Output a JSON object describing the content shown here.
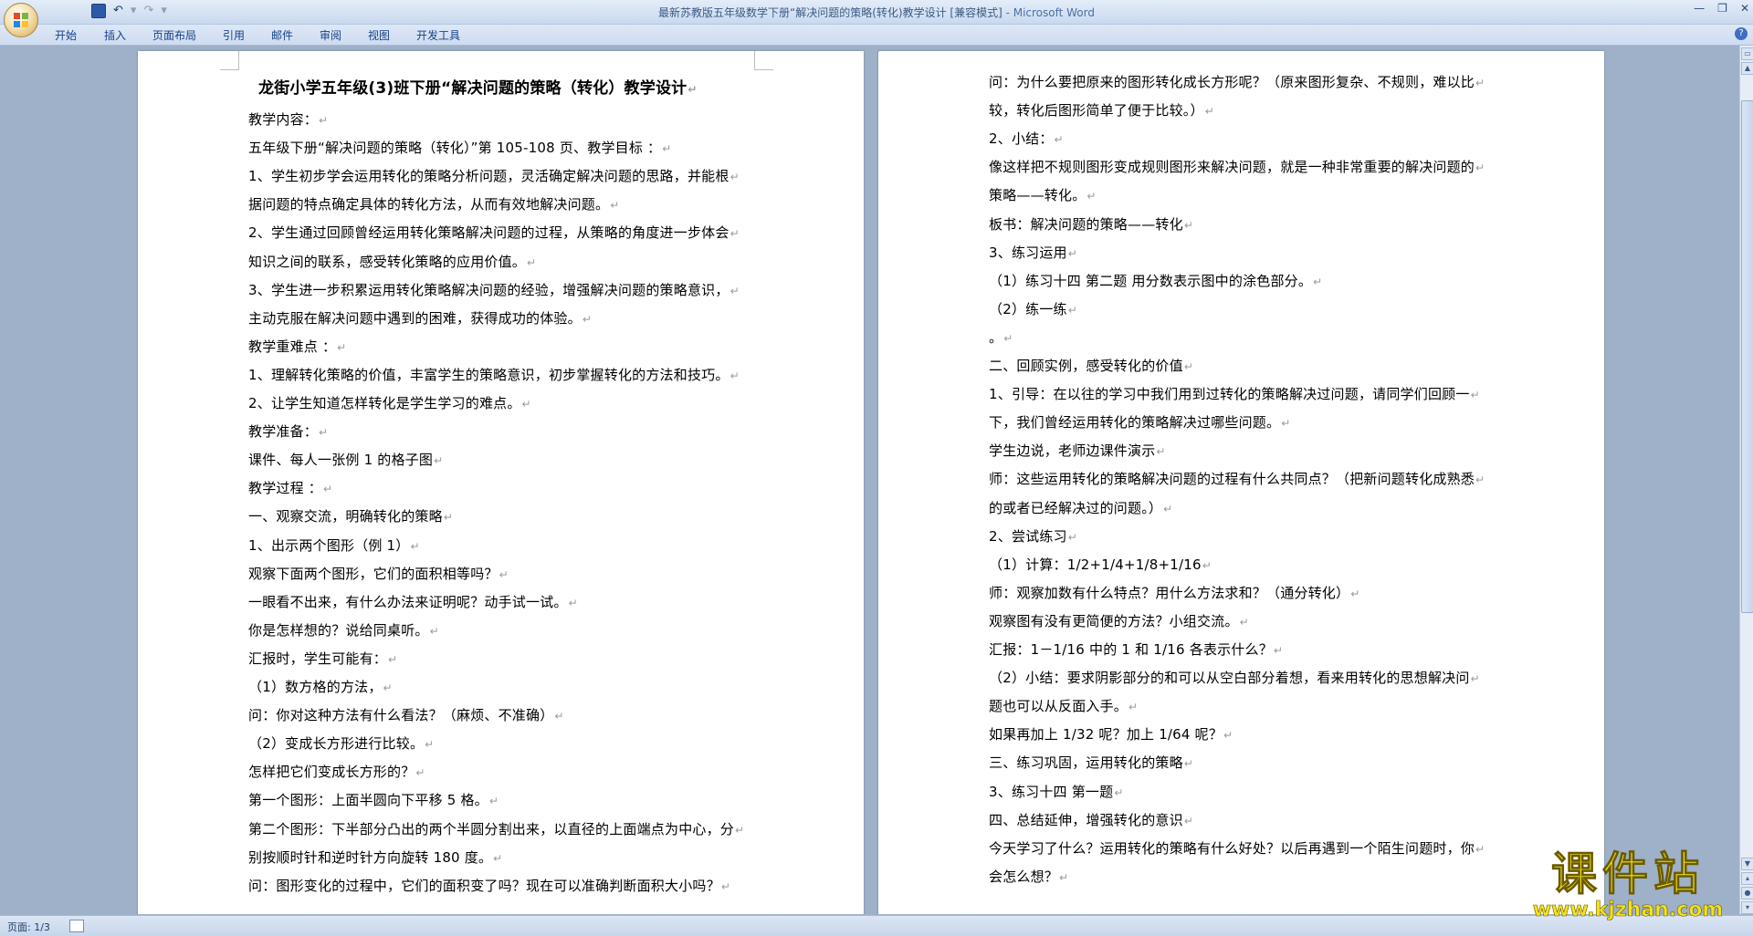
{
  "window": {
    "title": "最新苏教版五年级数学下册“解决问题的策略(转化)教学设计 [兼容模式]",
    "app_name": " - Microsoft Word"
  },
  "ribbon_tabs": [
    "开始",
    "插入",
    "页面布局",
    "引用",
    "邮件",
    "审阅",
    "视图",
    "开发工具"
  ],
  "status": {
    "page": "页面: 1/3"
  },
  "page1": {
    "title": "龙街小学五年级(3)班下册“解决问题的策略（转化）教学设计",
    "lines": [
      "教学内容：",
      "五年级下册“解决问题的策略（转化）”第 105-108 页、教学目标 ：",
      "1、学生初步学会运用转化的策略分析问题，灵活确定解决问题的思路，并能根",
      "据问题的特点确定具体的转化方法，从而有效地解决问题。",
      "2、学生通过回顾曾经运用转化策略解决问题的过程，从策略的角度进一步体会",
      "知识之间的联系，感受转化策略的应用价值。",
      "3、学生进一步积累运用转化策略解决问题的经验，增强解决问题的策略意识，",
      "主动克服在解决问题中遇到的困难，获得成功的体验。",
      "教学重难点 ：",
      "1、理解转化策略的价值，丰富学生的策略意识，初步掌握转化的方法和技巧。",
      "2、让学生知道怎样转化是学生学习的难点。",
      "教学准备：",
      "课件、每人一张例 1 的格子图",
      "教学过程 ：",
      "一、观察交流，明确转化的策略",
      "1、出示两个图形（例 1）",
      "观察下面两个图形，它们的面积相等吗？",
      "一眼看不出来，有什么办法来证明呢？动手试一试。",
      "你是怎样想的？说给同桌听。",
      "汇报时，学生可能有：",
      "（1）数方格的方法，",
      "问：你对这种方法有什么看法？（麻烦、不准确）",
      "（2）变成长方形进行比较。",
      "怎样把它们变成长方形的？",
      "第一个图形：上面半圆向下平移 5 格。",
      "第二个图形：下半部分凸出的两个半圆分割出来，以直径的上面端点为中心，分",
      "别按顺时针和逆时针方向旋转 180 度。",
      "问：图形变化的过程中，它们的面积变了吗？现在可以准确判断面积大小吗？"
    ]
  },
  "page2": {
    "lines": [
      "问：为什么要把原来的图形转化成长方形呢？（原来图形复杂、不规则，难以比",
      "较，转化后图形简单了便于比较。）",
      "2、小结：",
      "像这样把不规则图形变成规则图形来解决问题，就是一种非常重要的解决问题的",
      "策略——转化。",
      "板书：解决问题的策略——转化",
      "3、练习运用",
      "（1）练习十四 第二题 用分数表示图中的涂色部分。",
      "（2）练一练",
      "。",
      "二、回顾实例，感受转化的价值",
      "1、引导：在以往的学习中我们用到过转化的策略解决过问题，请同学们回顾一",
      "下，我们曾经运用转化的策略解决过哪些问题。",
      "学生边说，老师边课件演示",
      "师：这些运用转化的策略解决问题的过程有什么共同点？（把新问题转化成熟悉",
      "的或者已经解决过的问题。）",
      "2、尝试练习",
      "（1）计算：1/2+1/4+1/8+1/16",
      "师：观察加数有什么特点？用什么方法求和？（通分转化）",
      "   观察图有没有更简便的方法？小组交流。",
      "汇报：1－1/16 中的 1 和 1/16 各表示什么？",
      "（2）小结：要求阴影部分的和可以从空白部分着想，看来用转化的思想解决问",
      "题也可以从反面入手。",
      "如果再加上 1/32 呢？加上 1/64 呢？",
      "三、练习巩固，运用转化的策略",
      "3、练习十四 第一题",
      "四、总结延伸，增强转化的意识",
      "今天学习了什么？运用转化的策略有什么好处？以后再遇到一个陌生问题时，你",
      "会怎么想？"
    ]
  },
  "watermark": {
    "text": "课件站",
    "url": "www.kjzhan.com"
  },
  "colors": {
    "accent": "#15428b",
    "watermark": "#f4e21b"
  }
}
